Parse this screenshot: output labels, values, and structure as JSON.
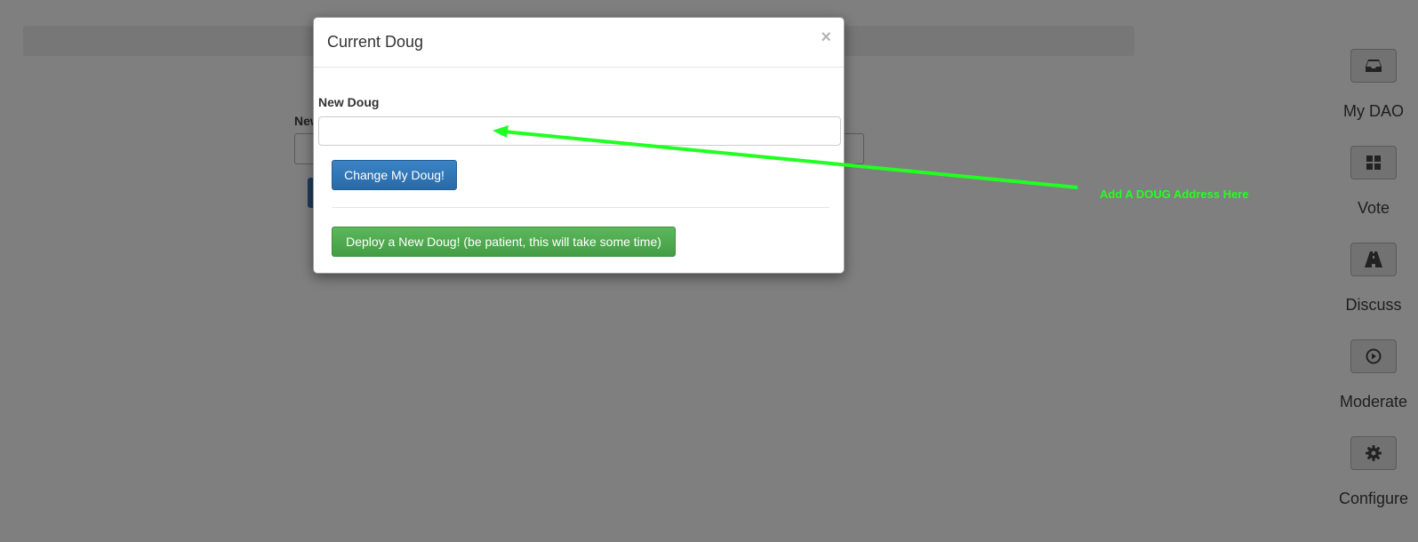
{
  "background": {
    "field_label": "New"
  },
  "modal": {
    "title": "Current Doug",
    "close_symbol": "×",
    "field_label": "New Doug",
    "input_value": "",
    "change_button": "Change My Doug!",
    "deploy_button": "Deploy a New Doug! (be patient, this will take some time)"
  },
  "sidenav": {
    "items": [
      {
        "label": "My DAO",
        "icon": "inbox-icon"
      },
      {
        "label": "Vote",
        "icon": "grid-icon"
      },
      {
        "label": "Discuss",
        "icon": "road-icon"
      },
      {
        "label": "Moderate",
        "icon": "play-circle-icon"
      },
      {
        "label": "Configure",
        "icon": "gear-icon"
      }
    ]
  },
  "annotation": {
    "text": "Add A DOUG Address Here",
    "color": "#22ff22"
  },
  "colors": {
    "overlay": "#7f7f7f",
    "primary": "#337ab7",
    "success": "#5cb85c"
  }
}
